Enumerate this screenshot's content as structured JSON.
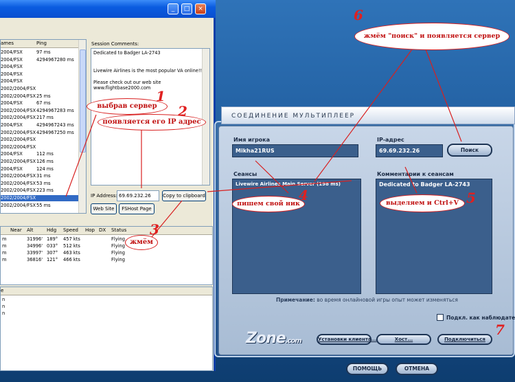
{
  "left_window": {
    "title_buttons": [
      "_",
      "□",
      "×"
    ],
    "sessions_headers": {
      "games": "ames",
      "ping": "Ping"
    },
    "sessions": [
      {
        "game": "2004/FSX",
        "ping": "97 ms"
      },
      {
        "game": "2004/FSX",
        "ping": "4294967280 ms"
      },
      {
        "game": "2004/FSX",
        "ping": ""
      },
      {
        "game": "2004/FSX",
        "ping": ""
      },
      {
        "game": "2004/FSX",
        "ping": ""
      },
      {
        "game": "2002/2004/FSX",
        "ping": ""
      },
      {
        "game": "2002/2004/FSX",
        "ping": "25 ms"
      },
      {
        "game": "2004/FSX",
        "ping": "67 ms"
      },
      {
        "game": "2002/2004/FSX",
        "ping": "4294967283 ms"
      },
      {
        "game": "2002/2004/FSX",
        "ping": "217 ms"
      },
      {
        "game": "2004/FSX",
        "ping": "4294967243 ms"
      },
      {
        "game": "2002/2004/FSX",
        "ping": "4294967250 ms"
      },
      {
        "game": "2002/2004/FSX",
        "ping": ""
      },
      {
        "game": "2002/2004/FSX",
        "ping": ""
      },
      {
        "game": "2004/FSX",
        "ping": "112 ms"
      },
      {
        "game": "2002/2004/FSX",
        "ping": "126 ms"
      },
      {
        "game": "2004/FSX",
        "ping": "124 ms"
      },
      {
        "game": "2002/2004/FSX",
        "ping": "31 ms"
      },
      {
        "game": "2002/2004/FSX",
        "ping": "53 ms"
      },
      {
        "game": "2002/2004/FSX",
        "ping": "223 ms"
      },
      {
        "game": "2002/2004/FSX",
        "ping": ""
      },
      {
        "game": "2002/2004/FSX",
        "ping": "55 ms"
      }
    ],
    "selected_index": 20,
    "session_comments_label": "Session Comments:",
    "comments": [
      "Dedicated to Badger LA-2743",
      "",
      "",
      "Livewire Airlines is the most popular VA online!!!",
      "",
      "Please check out our web site",
      "www.flightbase2000.com"
    ],
    "ip_label": "IP Address:",
    "ip_value": "69.69.232.26",
    "copy_button": "Copy to clipboard",
    "website_button": "Web Site",
    "fshost_button": "FSHost Page",
    "player_headers": [
      "Near",
      "Alt",
      "Hdg",
      "Speed",
      "Hop",
      "DX",
      "Status"
    ],
    "players": [
      {
        "near": "m",
        "alt": "31996'",
        "hdg": "189°",
        "speed": "457 kts",
        "status": "Flying"
      },
      {
        "near": "m",
        "alt": "34996'",
        "hdg": "033°",
        "speed": "512 kts",
        "status": "Flying"
      },
      {
        "near": "m",
        "alt": "33997'",
        "hdg": "307°",
        "speed": "463 kts",
        "status": "Flying"
      },
      {
        "near": "m",
        "alt": "36816'",
        "hdg": "121°",
        "speed": "466 kts",
        "status": "Flying"
      }
    ],
    "chat_header": "e",
    "chat_lines": [
      "n",
      "n",
      "n"
    ]
  },
  "mp_dialog": {
    "title": "СОЕДИНЕНИЕ МУЛЬТИПЛЕЕР",
    "player_name_label": "Имя игрока",
    "player_name_value": "Mikha21RUS",
    "ip_label": "IP-адрес",
    "ip_value": "69.69.232.26",
    "search_button": "Поиск",
    "sessions_label": "Сеансы",
    "sessions": [
      "Livewire Airlines Main Server (198 ms)"
    ],
    "comments_label": "Комментарии к сеансам",
    "comments_value": "Dedicated to Badger LA-2743",
    "note_label": "Примечание:",
    "note_text": "во время онлайновой игры опыт может изменяться",
    "observer_label": "Подкл. как наблюдатель",
    "logo": "Zone",
    "logo_suffix": ".com",
    "client_settings_button": "Установки клиента...",
    "host_button": "Хост...",
    "connect_button": "Подключиться",
    "help_button": "ПОМОЩЬ",
    "cancel_button": "ОТМЕНА"
  },
  "annotations": {
    "n1": "1",
    "n1_text": "выбрав сервер",
    "n2": "2",
    "n2_text": "появляется его IP адрес",
    "n3": "3",
    "n3_text": "жмём",
    "n4": "4",
    "n4_text": "пишем свой ник",
    "n5": "5",
    "n5_text": "выделяем и Ctrl+V",
    "n6": "6",
    "n6_text": "жмём \"поиск\" и появляется сервер",
    "n7": "7",
    "color": "#d82020"
  }
}
